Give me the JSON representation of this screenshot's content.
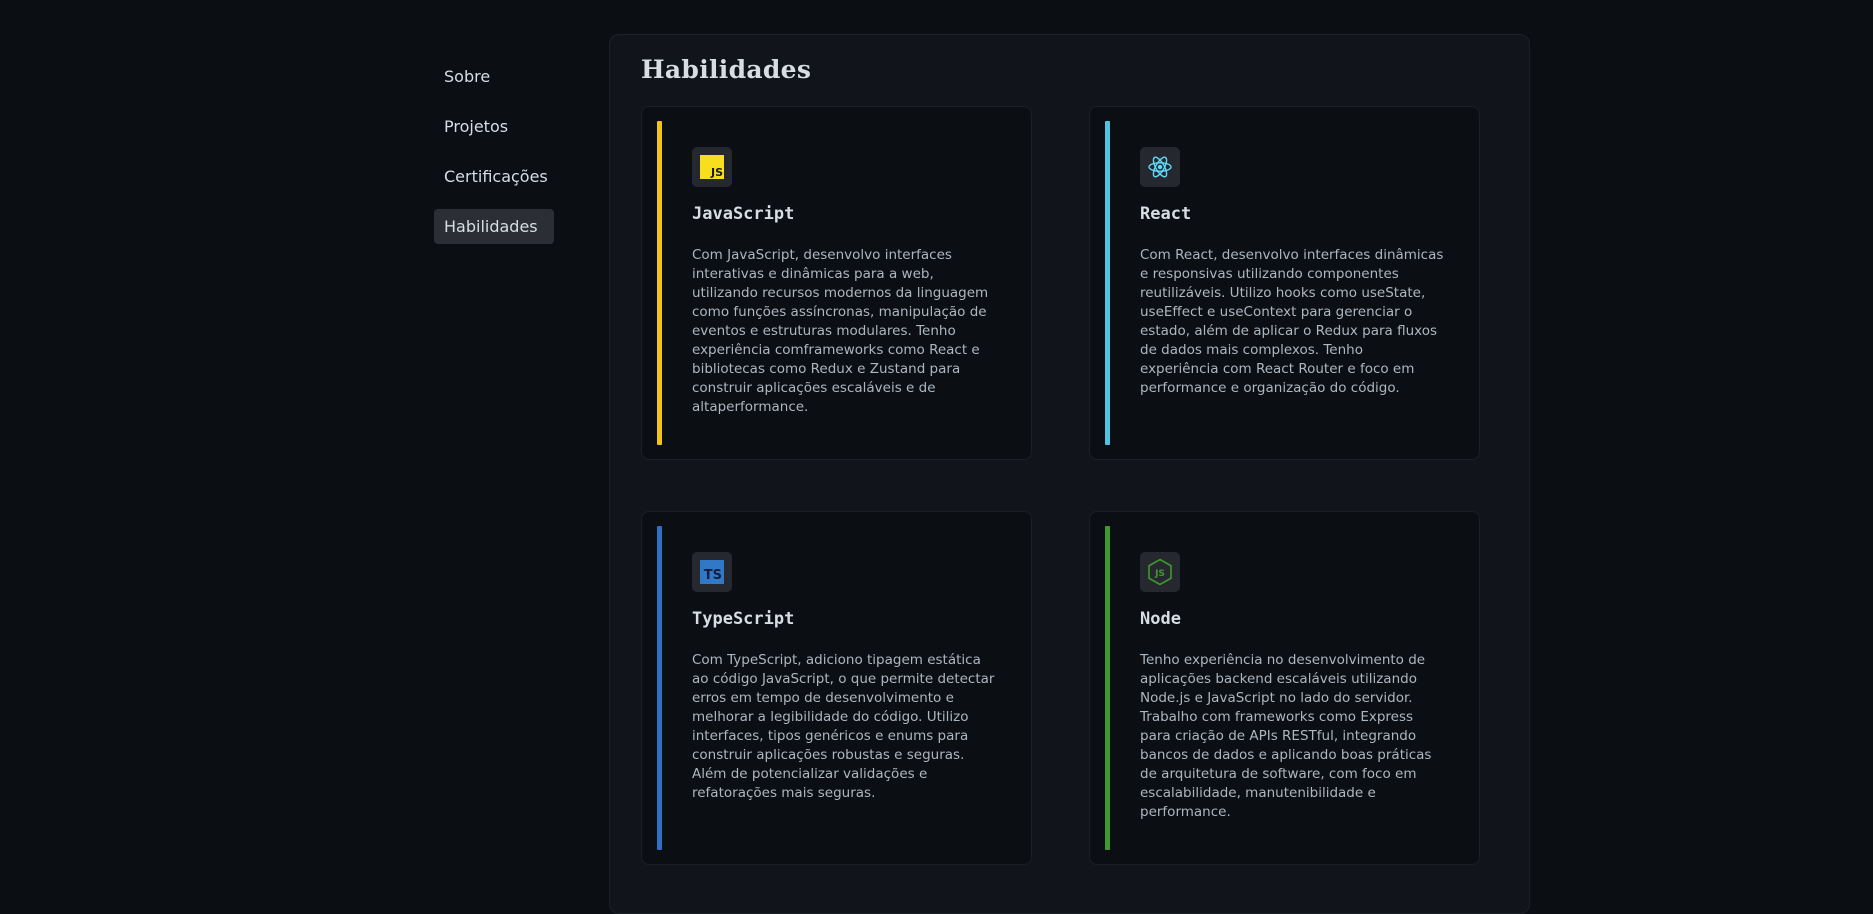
{
  "nav": {
    "items": [
      {
        "label": "Sobre"
      },
      {
        "label": "Projetos"
      },
      {
        "label": "Certificações"
      },
      {
        "label": "Habilidades"
      }
    ],
    "active": "Habilidades"
  },
  "section": {
    "title": "Habilidades"
  },
  "skills": [
    {
      "name": "JavaScript",
      "icon": "javascript-icon",
      "icon_text": "JS",
      "accent": "#f0c419",
      "description": "Com JavaScript, desenvolvo interfaces interativas e dinâmicas para a web, utilizando recursos modernos da linguagem como funções assíncronas, manipulação de eventos e estruturas modulares. Tenho experiência comframeworks como React e bibliotecas como Redux e Zustand para construir aplicações escaláveis e de altaperformance."
    },
    {
      "name": "React",
      "icon": "react-icon",
      "accent": "#4fc3e0",
      "description": "Com React, desenvolvo interfaces dinâmicas e responsivas utilizando componentes reutilizáveis. Utilizo hooks como useState, useEffect e useContext para gerenciar o estado, além de aplicar o Redux para fluxos de dados mais complexos. Tenho experiência com React Router e foco em performance e organização do código."
    },
    {
      "name": "TypeScript",
      "icon": "typescript-icon",
      "icon_text": "TS",
      "accent": "#2f6fc4",
      "description": "Com TypeScript, adiciono tipagem estática ao código JavaScript, o que permite detectar erros em tempo de desenvolvimento e melhorar a legibilidade do código. Utilizo interfaces, tipos genéricos e enums para construir aplicações robustas e seguras. Além de potencializar validações e refatorações mais seguras."
    },
    {
      "name": "Node",
      "icon": "nodejs-icon",
      "accent": "#3c9a2e",
      "description": "Tenho experiência no desenvolvimento de aplicações backend escaláveis utilizando Node.js e JavaScript no lado do servidor. Trabalho com frameworks como Express para criação de APIs RESTful, integrando bancos de dados e aplicando boas práticas de arquitetura de software, com foco em escalabilidade, manutenibilidade e performance."
    }
  ]
}
